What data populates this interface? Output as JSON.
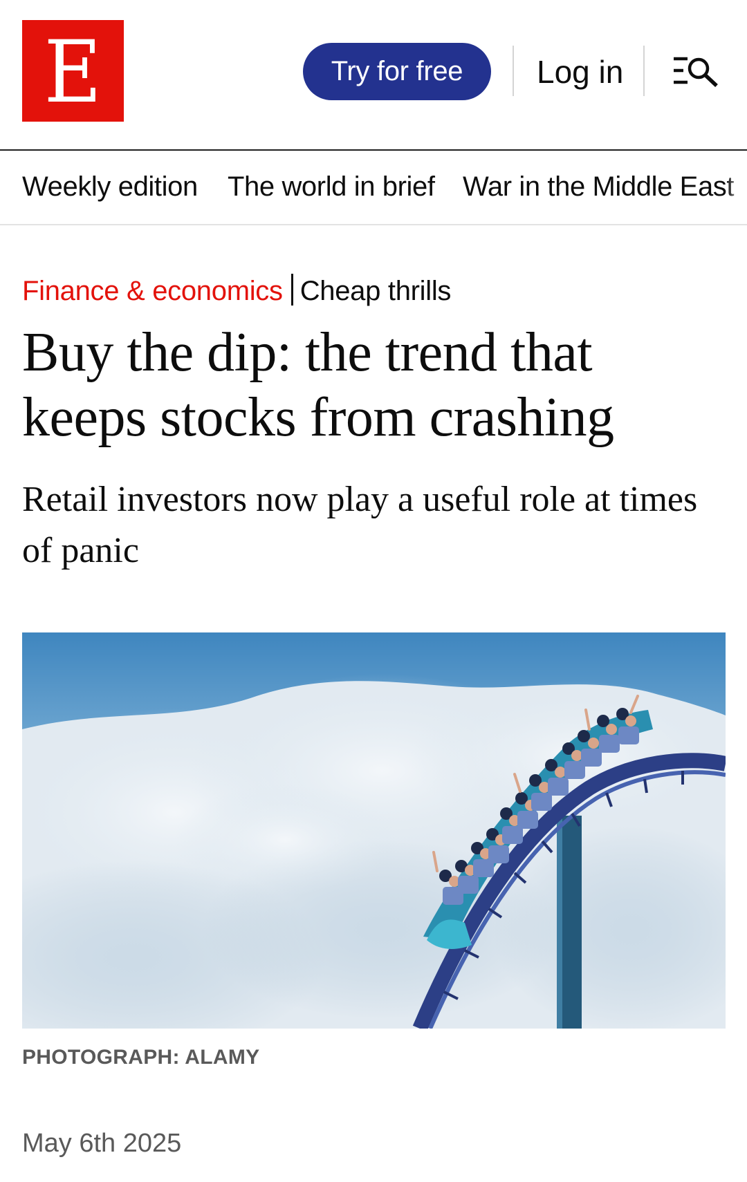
{
  "header": {
    "logo_letter": "E",
    "try_button_label": "Try for free",
    "login_label": "Log in",
    "menu_icon": "menu-search-icon"
  },
  "nav": {
    "items": [
      {
        "label": "Weekly edition"
      },
      {
        "label": "The world in brief"
      },
      {
        "label": "War in the Middle East"
      }
    ]
  },
  "article": {
    "section": "Finance & economics",
    "flytitle": "Cheap thrills",
    "headline_line1": "Buy the dip: the trend that",
    "headline_line2": "keeps stocks from crashing",
    "standfirst": "Retail investors now play a useful role at times of panic",
    "image_caption": "PHOTOGRAPH: ALAMY",
    "date": "May 6th 2025"
  },
  "colors": {
    "brand_red": "#e3120b",
    "button_blue": "#23328f",
    "text": "#0d0d0d",
    "muted": "#595959"
  }
}
